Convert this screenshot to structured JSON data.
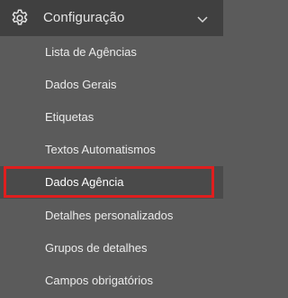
{
  "menu": {
    "title": "Configuração",
    "icon": "gear-icon",
    "expand_icon": "chevron-down-icon",
    "items": [
      {
        "label": "Lista de Agências",
        "active": false
      },
      {
        "label": "Dados Gerais",
        "active": false
      },
      {
        "label": "Etiquetas",
        "active": false
      },
      {
        "label": "Textos Automatismos",
        "active": false
      },
      {
        "label": "Dados Agência",
        "active": true
      },
      {
        "label": "Detalhes personalizados",
        "active": false
      },
      {
        "label": "Grupos de detalhes",
        "active": false
      },
      {
        "label": "Campos obrigatórios",
        "active": false
      }
    ]
  },
  "colors": {
    "header_bg": "#404040",
    "menu_bg": "#5b5b5b",
    "highlight": "#e01e1e"
  }
}
